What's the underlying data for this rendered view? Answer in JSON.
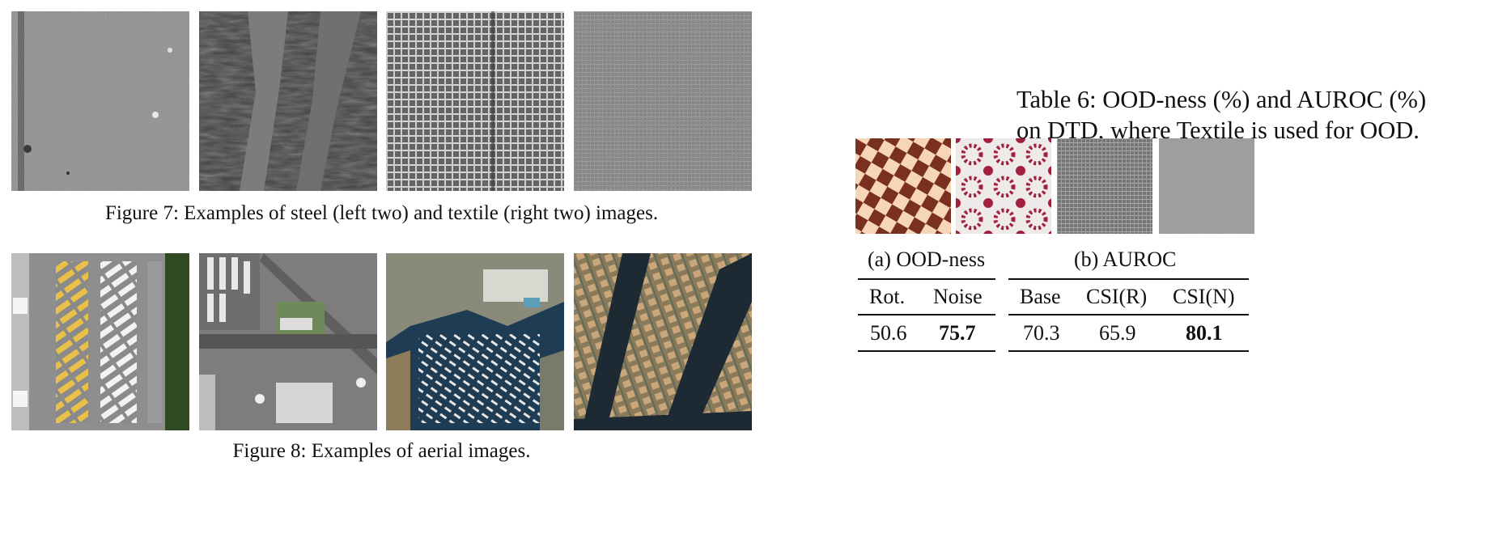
{
  "figure7": {
    "caption": "Figure 7: Examples of steel (left two) and textile (right two) images.",
    "images": [
      "steel-sample-1",
      "steel-sample-2",
      "textile-sample-1",
      "textile-sample-2"
    ]
  },
  "figure8": {
    "caption": "Figure 8: Examples of aerial images.",
    "images": [
      "aerial-parking-lot",
      "aerial-airport",
      "aerial-marina",
      "aerial-residential"
    ]
  },
  "table6": {
    "caption_line1": "Table 6: OOD-ness (%) and AUROC (%)",
    "caption_line2": "on DTD, where Textile is used for OOD.",
    "images": [
      "dtd-checkered",
      "dtd-pattern",
      "textile-dark",
      "textile-light"
    ],
    "group_a": "(a) OOD-ness",
    "group_b": "(b) AUROC",
    "headers": [
      "Rot.",
      "Noise",
      "Base",
      "CSI(R)",
      "CSI(N)"
    ],
    "values": [
      "50.6",
      "75.7",
      "70.3",
      "65.9",
      "80.1"
    ],
    "bold_columns": [
      "Noise",
      "CSI(N)"
    ]
  }
}
